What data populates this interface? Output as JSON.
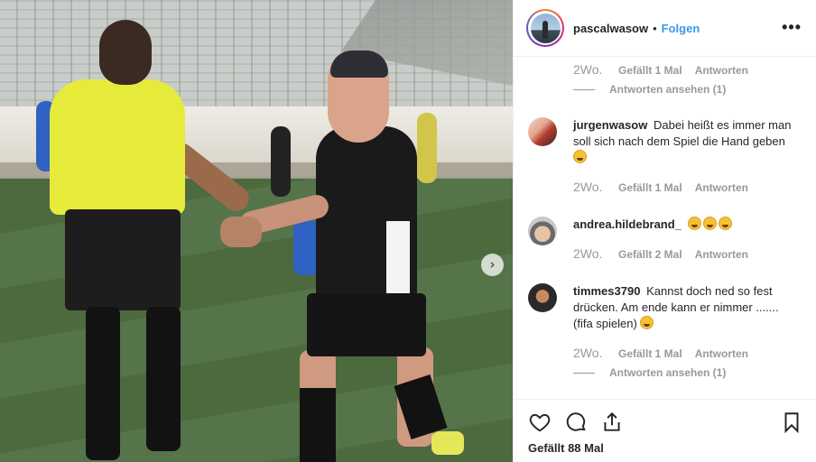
{
  "header": {
    "username": "pascalwasow",
    "separator": "•",
    "follow_label": "Folgen",
    "more_label": "•••"
  },
  "photo": {
    "next_label": "›"
  },
  "comments": [
    {
      "id": "c0",
      "partial": true,
      "age": "2Wo.",
      "likes": "Gefällt 1 Mal",
      "reply": "Antworten",
      "view_replies": "Antworten ansehen (1)"
    },
    {
      "id": "c1",
      "username": "jurgenwasow",
      "text": "Dabei heißt es immer man soll sich nach dem Spiel die Hand geben",
      "emoji": "thinking",
      "age": "2Wo.",
      "likes": "Gefällt 1 Mal",
      "reply": "Antworten"
    },
    {
      "id": "c2",
      "username": "andrea.hildebrand_",
      "text": "",
      "emoji_count": 3,
      "age": "2Wo.",
      "likes": "Gefällt 2 Mal",
      "reply": "Antworten"
    },
    {
      "id": "c3",
      "username": "timmes3790",
      "text": "Kannst doch ned so fest drücken. Am ende kann er nimmer ....... (fifa spielen)",
      "emoji": "laughing",
      "age": "2Wo.",
      "likes": "Gefällt 1 Mal",
      "reply": "Antworten",
      "view_replies": "Antworten ansehen (1)"
    }
  ],
  "actions": {
    "likes_count": "Gefällt 88 Mal"
  },
  "colors": {
    "accent": "#3897f0",
    "meta_gray": "#999999",
    "text": "#262626",
    "divider": "#efefef"
  }
}
